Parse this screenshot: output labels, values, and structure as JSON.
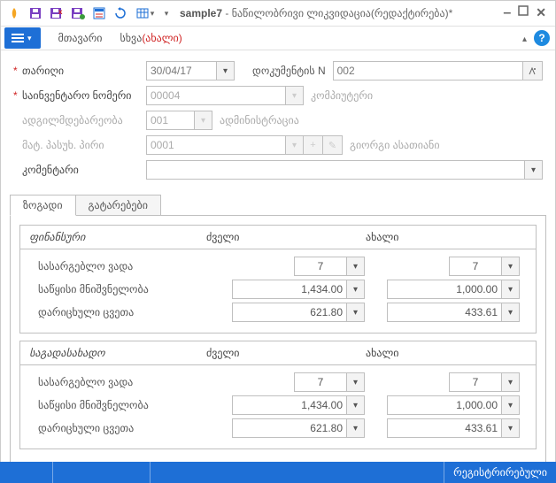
{
  "window": {
    "title_prefix": "sample7",
    "title_suffix": " - ნაწილობრივი ლიკვიდაცია(რედაქტირება)*"
  },
  "ribbon": {
    "main_tab": "მთავარი",
    "other_tab_prefix": "სხვა",
    "other_tab_suffix": "(ახალი)"
  },
  "form": {
    "date_label": "თარიღი",
    "date_value": "30/04/17",
    "doc_label": "დოკუმენტის N",
    "doc_value": "002",
    "inventory_label": "საინვენტარო ნომერი",
    "inventory_value": "00004",
    "inventory_desc": "კომპიუტერი",
    "location_label": "ადგილმდებარეობა",
    "location_value": "001",
    "location_desc": "ადმინისტრაცია",
    "responsible_label": "მატ. პასუხ. პირი",
    "responsible_value": "0001",
    "responsible_desc": "გიორგი ასათიანი",
    "comment_label": "კომენტარი",
    "comment_value": ""
  },
  "tabs": {
    "general": "ზოგადი",
    "postings": "გატარებები"
  },
  "sections": {
    "financial": "ფინანსური",
    "tax": "საგადასახადო",
    "old": "ძველი",
    "new": "ახალი",
    "useful_life": "სასარგებლო ვადა",
    "initial_value": "საწყისი მნიშვნელობა",
    "accum_depr": "დარიცხული ცვეთა"
  },
  "values": {
    "fin_life_old": "7",
    "fin_life_new": "7",
    "fin_init_old": "1,434.00",
    "fin_init_new": "1,000.00",
    "fin_depr_old": "621.80",
    "fin_depr_new": "433.61",
    "tax_life_old": "7",
    "tax_life_new": "7",
    "tax_init_old": "1,434.00",
    "tax_init_new": "1,000.00",
    "tax_depr_old": "621.80",
    "tax_depr_new": "433.61"
  },
  "status": {
    "text": "რეგისტრირებული"
  }
}
